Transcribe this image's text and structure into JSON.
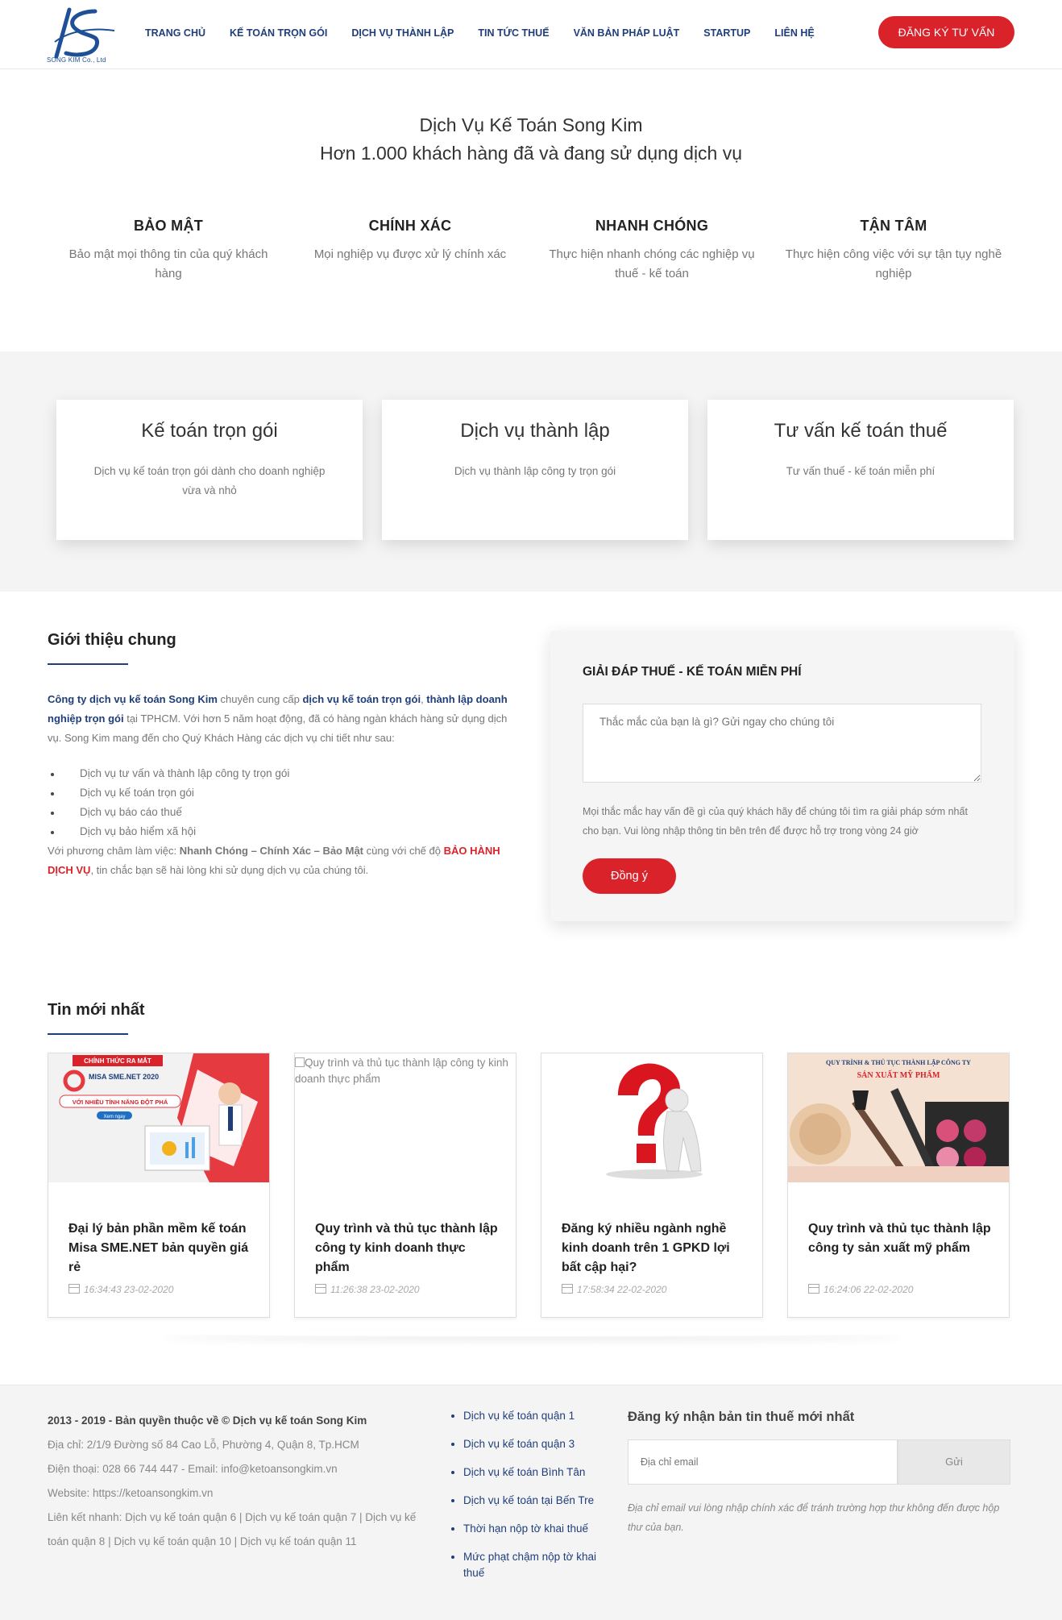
{
  "header": {
    "logo_text": "SONG KIM Co., Ltd",
    "nav": [
      "TRANG CHỦ",
      "KẾ TOÁN TRỌN GÓI",
      "DỊCH VỤ THÀNH LẬP",
      "TIN TỨC THUẾ",
      "VĂN BẢN PHÁP LUẬT",
      "STARTUP",
      "LIÊN HỆ"
    ],
    "cta_label": "ĐĂNG KÝ TƯ VẤN"
  },
  "hero": {
    "line1": "Dịch Vụ Kế Toán Song Kim",
    "line2": "Hơn 1.000 khách hàng đã và đang sử dụng dịch vụ"
  },
  "features": [
    {
      "title": "BẢO MẬT",
      "text": "Bảo mật mọi thông tin của quý khách hàng"
    },
    {
      "title": "CHÍNH XÁC",
      "text": "Mọi nghiệp vụ được xử lý chính xác"
    },
    {
      "title": "NHANH CHÓNG",
      "text": "Thực hiện nhanh chóng các nghiệp vụ thuế - kế toán"
    },
    {
      "title": "TẬN TÂM",
      "text": "Thực hiện công việc với sự tận tụy nghề nghiệp"
    }
  ],
  "services": [
    {
      "title": "Kế toán trọn gói",
      "text": "Dịch vụ kế toán trọn gói dành cho doanh nghiệp vừa và nhỏ"
    },
    {
      "title": "Dịch vụ thành lập",
      "text": "Dịch vụ thành lập công ty trọn gói"
    },
    {
      "title": "Tư vấn kế toán thuế",
      "text": "Tư vấn thuế - kế toán miễn phí"
    }
  ],
  "intro": {
    "title": "Giới thiệu chung",
    "p1_link1": "Công ty dịch vụ kế toán Song Kim",
    "p1_t1": " chuyên cung cấp ",
    "p1_link2": "dịch vụ kế toán trọn gói",
    "p1_t2": ", ",
    "p1_link3": "thành lập doanh nghiệp trọn gói",
    "p1_t3": " tại TPHCM. Với hơn 5 năm hoạt động, đã có hàng ngàn khách hàng sử dụng dịch vụ. Song Kim mang đến cho Quý Khách Hàng các dịch vụ chi tiết như sau:",
    "list": [
      "Dịch vụ tư vấn và thành lập công ty trọn gói",
      "Dịch vụ kế toán trọn gói",
      "Dịch vụ báo cáo thuế",
      "Dịch vụ bảo hiểm xã hội"
    ],
    "foot_t1": "Với phương châm làm việc: ",
    "foot_bold": "Nhanh Chóng – Chính Xác – Bảo Mật",
    "foot_t2": " cùng với chế độ ",
    "foot_red": "BẢO HÀNH DỊCH VỤ",
    "foot_t3": ", tin chắc bạn sẽ hài lòng khi sử dụng dịch vụ của chúng tôi."
  },
  "qa": {
    "title": "GIẢI ĐÁP THUẾ - KẾ TOÁN MIỄN PHÍ",
    "placeholder": "Thắc mắc của bạn là gì? Gửi ngay cho chúng tôi",
    "note": "Mọi thắc mắc hay vấn đề gì của quý khách hãy để chúng tôi tìm ra giải pháp sớm nhất cho bạn. Vui lòng nhập thông tin bên trên để được hỗ trợ trong vòng 24 giờ",
    "button": "Đồng ý"
  },
  "news": {
    "title": "Tin mới nhất",
    "items": [
      {
        "title": "Đại lý bản phần mềm kế toán Misa SME.NET bản quyền giá rẻ",
        "date": "16:34:43 23-02-2020",
        "img_badge": "CHÍNH THỨC RA MẮT",
        "img_product": "MISA SME.NET 2020",
        "img_tagline": "VỚI NHIỀU TÍNH NĂNG ĐỘT PHÁ",
        "img_btn": "Xem ngay"
      },
      {
        "title": "Quy trình và thủ tục thành lập công ty kinh doanh thực phẩm",
        "date": "11:26:38 23-02-2020",
        "img_alt": "Quy trình và thủ tục thành lập công ty kinh doanh thực phẩm"
      },
      {
        "title": "Đăng ký nhiều ngành nghề kinh doanh trên 1 GPKD lợi bất cập hại?",
        "date": "17:58:34 22-02-2020"
      },
      {
        "title": "Quy trình và thủ tục thành lập công ty sản xuất mỹ phẩm",
        "date": "16:24:06 22-02-2020",
        "img_cap1": "QUY TRÌNH & THỦ TỤC THÀNH LẬP CÔNG TY",
        "img_cap2": "SẢN XUẤT MỸ PHẨM"
      }
    ]
  },
  "footer": {
    "copyright": "2013 - 2019 - Bản quyền thuộc về © Dịch vụ kế toán Song Kim",
    "address": "Địa chỉ: 2/1/9 Đường số 84 Cao Lỗ, Phường 4, Quận 8, Tp.HCM",
    "contact": "Điện thoại: 028 66 744 447  - Email: info@ketoansongkim.vn",
    "website": "Website: https://ketoansongkim.vn",
    "quicklinks_1": "Liên kết nhanh: Dịch vụ kế toán quận 6 | Dịch vụ kế toán quận 7 | Dịch vụ kế",
    "quicklinks_2": "toán quận 8 | Dịch vụ kế toán quận 10 | Dịch vụ kế toán quận 11",
    "links": [
      "Dịch vụ kế toán quận 1",
      "Dịch vụ kế toán quận 3",
      "Dịch vụ kế toán Bình Tân",
      "Dịch vụ kế toán tại Bến Tre",
      "Thời hạn nộp tờ khai thuế",
      "Mức phạt chậm nộp tờ khai thuế"
    ],
    "subscribe_title": "Đăng ký nhận bản tin thuế mới nhất",
    "email_placeholder": "Địa chỉ email",
    "send_label": "Gửi",
    "subscribe_note": "Địa chỉ email vui lòng nhập chính xác để tránh trường hợp thư không đến được hộp thư của bạn."
  },
  "colors": {
    "brand_blue": "#1f3e7a",
    "accent_red": "#d9222a"
  }
}
